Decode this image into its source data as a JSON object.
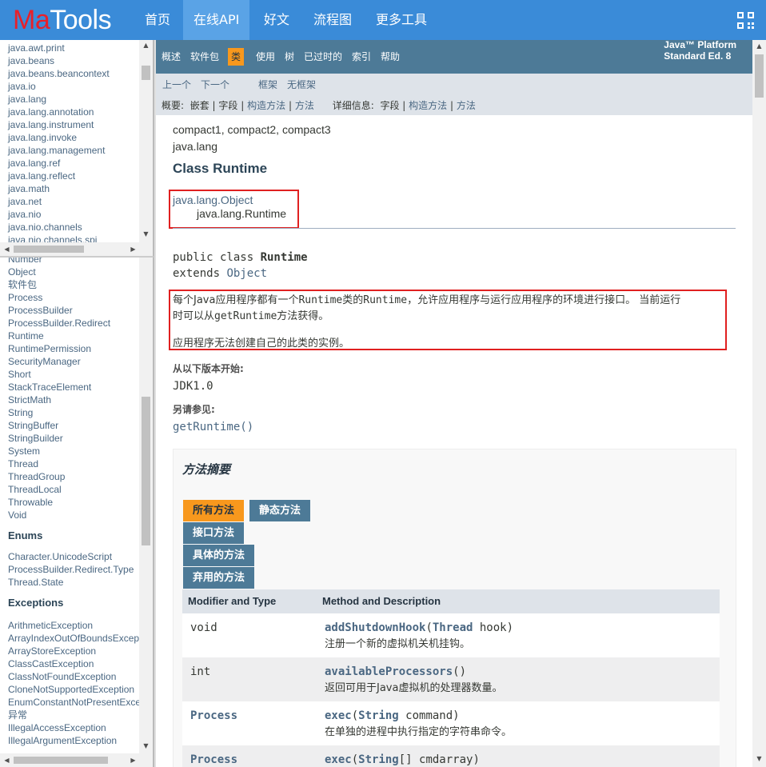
{
  "site": {
    "logo_ma": "Ma",
    "logo_tools": "Tools"
  },
  "nav": {
    "items": [
      "首页",
      "在线API",
      "好文",
      "流程图",
      "更多工具"
    ],
    "active": "在线API"
  },
  "packages": [
    "java.awt.print",
    "java.beans",
    "java.beans.beancontext",
    "java.io",
    "java.lang",
    "java.lang.annotation",
    "java.lang.instrument",
    "java.lang.invoke",
    "java.lang.management",
    "java.lang.ref",
    "java.lang.reflect",
    "java.math",
    "java.net",
    "java.nio",
    "java.nio.channels",
    "java.nio.channels.spi"
  ],
  "classes": [
    "Number",
    "Object",
    "软件包",
    "Process",
    "ProcessBuilder",
    "ProcessBuilder.Redirect",
    "Runtime",
    "RuntimePermission",
    "SecurityManager",
    "Short",
    "StackTraceElement",
    "StrictMath",
    "String",
    "StringBuffer",
    "StringBuilder",
    "System",
    "Thread",
    "ThreadGroup",
    "ThreadLocal",
    "Throwable",
    "Void"
  ],
  "enums_label": "Enums",
  "enums": [
    "Character.UnicodeScript",
    "ProcessBuilder.Redirect.Type",
    "Thread.State"
  ],
  "exceptions_label": "Exceptions",
  "exceptions": [
    "ArithmeticException",
    "ArrayIndexOutOfBoundsException",
    "ArrayStoreException",
    "ClassCastException",
    "ClassNotFoundException",
    "CloneNotSupportedException",
    "EnumConstantNotPresentException",
    "异常",
    "IllegalAccessException",
    "IllegalArgumentException"
  ],
  "topbar": {
    "items": [
      "概述",
      "软件包",
      "类",
      "使用",
      "树",
      "已过时的",
      "索引",
      "帮助"
    ],
    "active": "类",
    "platform_line1": "Java™ Platform",
    "platform_line2": "Standard Ed. 8"
  },
  "subnav": {
    "prev": "上一个",
    "next": "下一个",
    "frames": "框架",
    "noframes": "无框架",
    "summary_label": "概要:",
    "summary_nested": "嵌套",
    "summary_field": "字段",
    "summary_constr": "构造方法",
    "summary_method": "方法",
    "detail_label": "详细信息:",
    "detail_field": "字段",
    "detail_constr": "构造方法",
    "detail_method": "方法",
    "sep": "|"
  },
  "profiles": "compact1, compact2, compact3",
  "package_name": "java.lang",
  "class_title": "Class Runtime",
  "inheritance": {
    "parent": "java.lang.Object",
    "child": "java.lang.Runtime"
  },
  "signature": {
    "kw": "public class ",
    "name": "Runtime",
    "extends_kw": "extends ",
    "extends": "Object"
  },
  "description": {
    "p1a": "每个Java应用程序都有一个",
    "p1b": "Runtime",
    "p1c": "类的",
    "p1d": "Runtime",
    "p1e": "，允许应用程序与运行应用程序的环境进行接口。 当前运行",
    "p1f": "时可以从",
    "p1g": "getRuntime",
    "p1h": "方法获得。",
    "p2": "应用程序无法创建自己的此类的实例。"
  },
  "since_label": "从以下版本开始:",
  "since_value": "JDK1.0",
  "see_label": "另请参见:",
  "see_value": "getRuntime()",
  "method_summary": {
    "title": "方法摘要",
    "tabs": [
      "所有方法",
      "静态方法",
      "接口方法",
      "具体的方法",
      "弃用的方法"
    ],
    "col1": "Modifier and Type",
    "col2": "Method and Description",
    "rows": [
      {
        "mod": "void",
        "name": "addShutdownHook",
        "params_open": "(",
        "ptype": "Thread",
        "pname": " hook)",
        "desc": "注册一个新的虚拟机关机挂钩。"
      },
      {
        "mod": "int",
        "name": "availableProcessors",
        "params_open": "()",
        "ptype": "",
        "pname": "",
        "desc": "返回可用于Java虚拟机的处理器数量。"
      },
      {
        "mod": "Process",
        "name": "exec",
        "params_open": "(",
        "ptype": "String",
        "pname": " command)",
        "desc": "在单独的进程中执行指定的字符串命令。"
      },
      {
        "mod": "Process",
        "name": "exec",
        "params_open": "(",
        "ptype": "String",
        "pname": "[] cmdarray)",
        "desc": ""
      }
    ]
  }
}
